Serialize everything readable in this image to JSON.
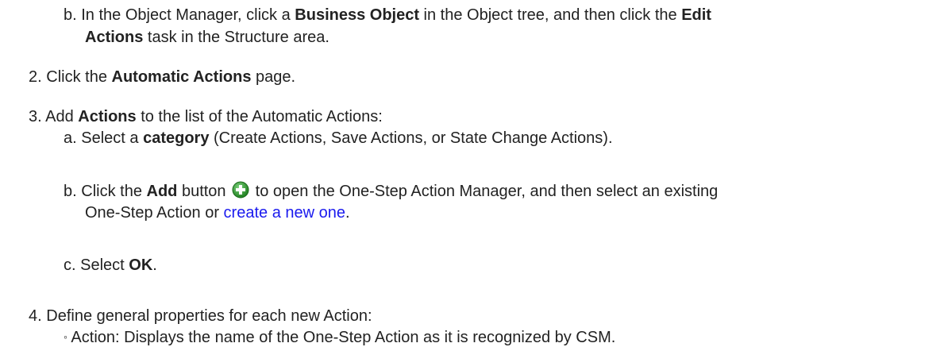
{
  "steps": {
    "s1b": {
      "marker": "b.",
      "t1": "In the Object Manager, click a ",
      "b1": "Business Object",
      "t2": " in the Object tree, and then click the ",
      "b2": "Edit",
      "b3": "Actions",
      "t3": " task in the Structure area."
    },
    "s2": {
      "marker": "2.",
      "t1": "Click the ",
      "b1": "Automatic Actions",
      "t2": " page."
    },
    "s3": {
      "marker": "3.",
      "t1": "Add ",
      "b1": "Actions",
      "t2": " to the list of the Automatic Actions:",
      "a": {
        "marker": "a.",
        "t1": "Select a ",
        "b1": "category",
        "t2": " (Create Actions, Save Actions, or State Change Actions)."
      },
      "b": {
        "marker": "b.",
        "t1": "Click the ",
        "b1": "Add",
        "t2": " button ",
        "icon": "add-circle-icon",
        "t3": " to open the One-Step Action Manager, and then select an existing",
        "t4": "One-Step Action or ",
        "link": "create a new one",
        "t5": "."
      },
      "c": {
        "marker": "c.",
        "t1": "Select ",
        "b1": "OK",
        "t2": "."
      }
    },
    "s4": {
      "marker": "4.",
      "t1": "Define general properties for each new Action:",
      "bullet": {
        "marker": "◦",
        "t1": "Action: Displays the name of the One-Step Action as it is recognized by CSM."
      }
    }
  },
  "colors": {
    "link": "#1a1aee",
    "icon_fill": "#2e9a2e",
    "text": "#222222"
  }
}
